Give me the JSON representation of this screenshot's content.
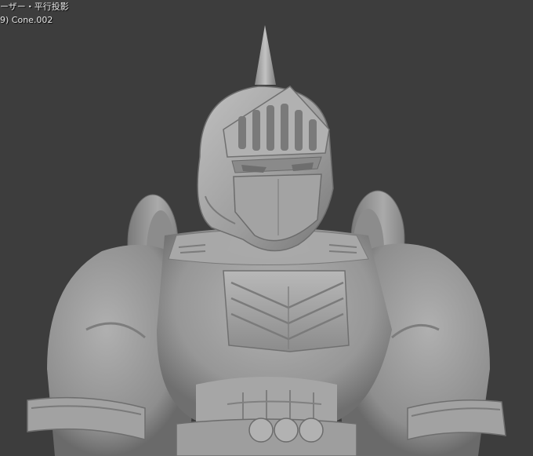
{
  "viewport": {
    "view_label": "ーザー・平行投影",
    "object_label": "9) Cone.002"
  },
  "colors": {
    "background": "#3d3d3d",
    "text": "#e6e6e6",
    "model_base": "#9a9a9a"
  }
}
